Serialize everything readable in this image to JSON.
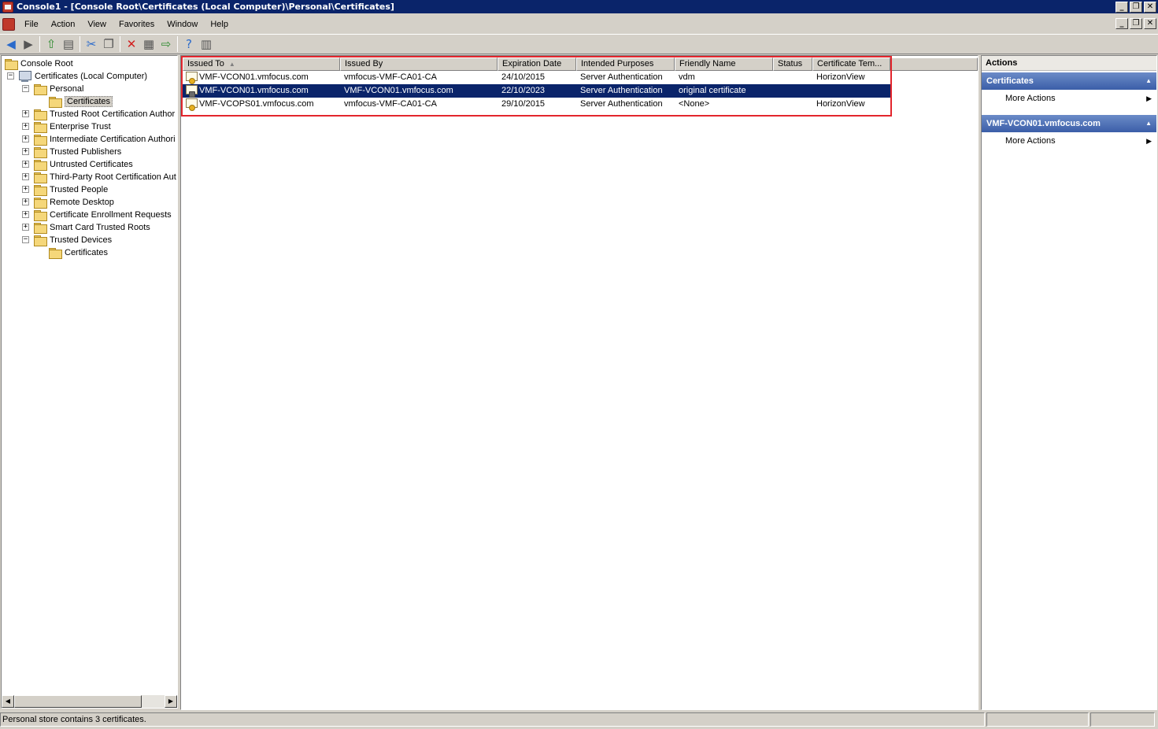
{
  "window": {
    "title": "Console1 - [Console Root\\Certificates (Local Computer)\\Personal\\Certificates]",
    "minimize": "_",
    "restore": "❐",
    "close": "✕"
  },
  "menu": [
    "File",
    "Action",
    "View",
    "Favorites",
    "Window",
    "Help"
  ],
  "toolbar_icons": [
    "back-icon",
    "forward-icon",
    "up-folder-icon",
    "show-hide-tree-icon",
    "cut-icon",
    "copy-icon",
    "delete-icon",
    "properties-icon",
    "export-list-icon",
    "help-icon",
    "show-hide-action-pane-icon"
  ],
  "tree": [
    {
      "label": "Console Root",
      "level": 0,
      "icon": "folder-icon",
      "expander": ""
    },
    {
      "label": "Certificates (Local Computer)",
      "level": 1,
      "icon": "computer-icon",
      "expander": "−"
    },
    {
      "label": "Personal",
      "level": 2,
      "icon": "folder-icon",
      "expander": "−"
    },
    {
      "label": "Certificates",
      "level": 3,
      "icon": "folder-icon",
      "expander": "",
      "selected": true
    },
    {
      "label": "Trusted Root Certification Author",
      "level": 2,
      "icon": "folder-icon",
      "expander": "+"
    },
    {
      "label": "Enterprise Trust",
      "level": 2,
      "icon": "folder-icon",
      "expander": "+"
    },
    {
      "label": "Intermediate Certification Authori",
      "level": 2,
      "icon": "folder-icon",
      "expander": "+"
    },
    {
      "label": "Trusted Publishers",
      "level": 2,
      "icon": "folder-icon",
      "expander": "+"
    },
    {
      "label": "Untrusted Certificates",
      "level": 2,
      "icon": "folder-icon",
      "expander": "+"
    },
    {
      "label": "Third-Party Root Certification Aut",
      "level": 2,
      "icon": "folder-icon",
      "expander": "+"
    },
    {
      "label": "Trusted People",
      "level": 2,
      "icon": "folder-icon",
      "expander": "+"
    },
    {
      "label": "Remote Desktop",
      "level": 2,
      "icon": "folder-icon",
      "expander": "+"
    },
    {
      "label": "Certificate Enrollment Requests",
      "level": 2,
      "icon": "folder-icon",
      "expander": "+"
    },
    {
      "label": "Smart Card Trusted Roots",
      "level": 2,
      "icon": "folder-icon",
      "expander": "+"
    },
    {
      "label": "Trusted Devices",
      "level": 2,
      "icon": "folder-icon",
      "expander": "−"
    },
    {
      "label": "Certificates",
      "level": 3,
      "icon": "folder-icon",
      "expander": ""
    }
  ],
  "columns": [
    "Issued To",
    "Issued By",
    "Expiration Date",
    "Intended Purposes",
    "Friendly Name",
    "Status",
    "Certificate Tem..."
  ],
  "sort_indicator": "▲",
  "rows": [
    {
      "issued_to": "VMF-VCON01.vmfocus.com",
      "issued_by": "vmfocus-VMF-CA01-CA",
      "expiration": "24/10/2015",
      "purposes": "Server Authentication",
      "friendly": "vdm",
      "status": "",
      "template": "HorizonView",
      "selected": false,
      "icon": "certificate-icon"
    },
    {
      "issued_to": "VMF-VCON01.vmfocus.com",
      "issued_by": "VMF-VCON01.vmfocus.com",
      "expiration": "22/10/2023",
      "purposes": "Server Authentication",
      "friendly": "original certificate",
      "status": "",
      "template": "",
      "selected": true,
      "icon": "certificate-key-icon"
    },
    {
      "issued_to": "VMF-VCOPS01.vmfocus.com",
      "issued_by": "vmfocus-VMF-CA01-CA",
      "expiration": "29/10/2015",
      "purposes": "Server Authentication",
      "friendly": "<None>",
      "status": "",
      "template": "HorizonView",
      "selected": false,
      "icon": "certificate-icon"
    }
  ],
  "actions": {
    "title": "Actions",
    "groups": [
      {
        "header": "Certificates",
        "items": [
          "More Actions"
        ]
      },
      {
        "header": "VMF-VCON01.vmfocus.com",
        "items": [
          "More Actions"
        ]
      }
    ]
  },
  "status": {
    "text": "Personal store contains 3 certificates."
  },
  "colors": {
    "titlebar": "#0a246a",
    "selection": "#0a246a",
    "highlight_box": "#e3262d",
    "action_header": "#3b5ea8"
  }
}
